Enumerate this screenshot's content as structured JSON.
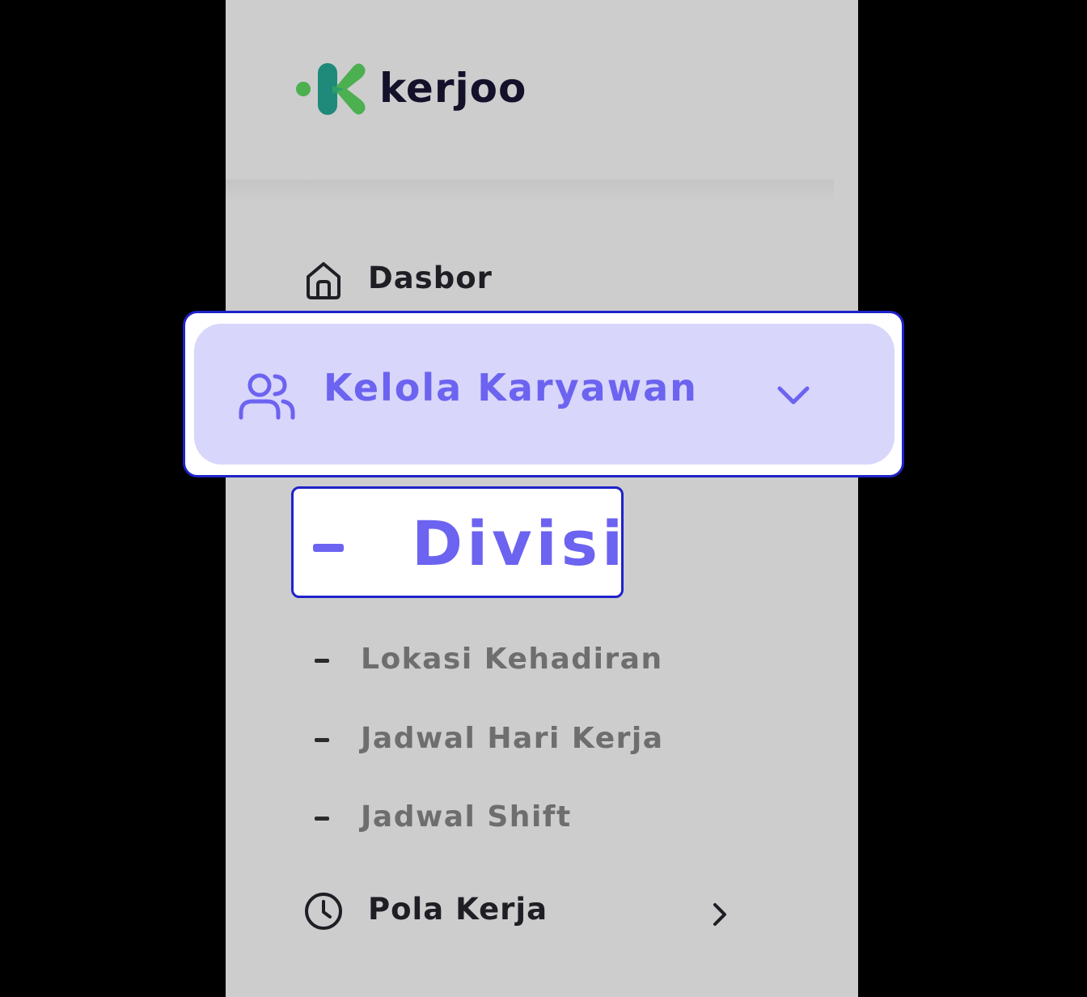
{
  "brand": {
    "name": "kerjoo",
    "mark_green": "#4caf50",
    "mark_teal": "#1f8a7a",
    "text_color": "#14112a"
  },
  "menu": {
    "dashboard": {
      "label": "Dasbor",
      "icon": "home-icon"
    },
    "manage_employees": {
      "label": "Kelola Karyawan",
      "icon": "users-icon",
      "expanded": true
    },
    "submenu": [
      {
        "label": "Divisi",
        "active": true
      },
      {
        "label": "Lokasi Kehadiran"
      },
      {
        "label": "Jadwal Hari Kerja"
      },
      {
        "label": "Jadwal Shift"
      }
    ],
    "work_pattern": {
      "label": "Pola Kerja",
      "icon": "clock-icon"
    }
  },
  "colors": {
    "accent": "#6c63f0",
    "highlight_bg": "#d8d6fb",
    "highlight_border": "#1f22c9",
    "sidebar_bg": "#cdcdcd",
    "backdrop": "#000000"
  }
}
